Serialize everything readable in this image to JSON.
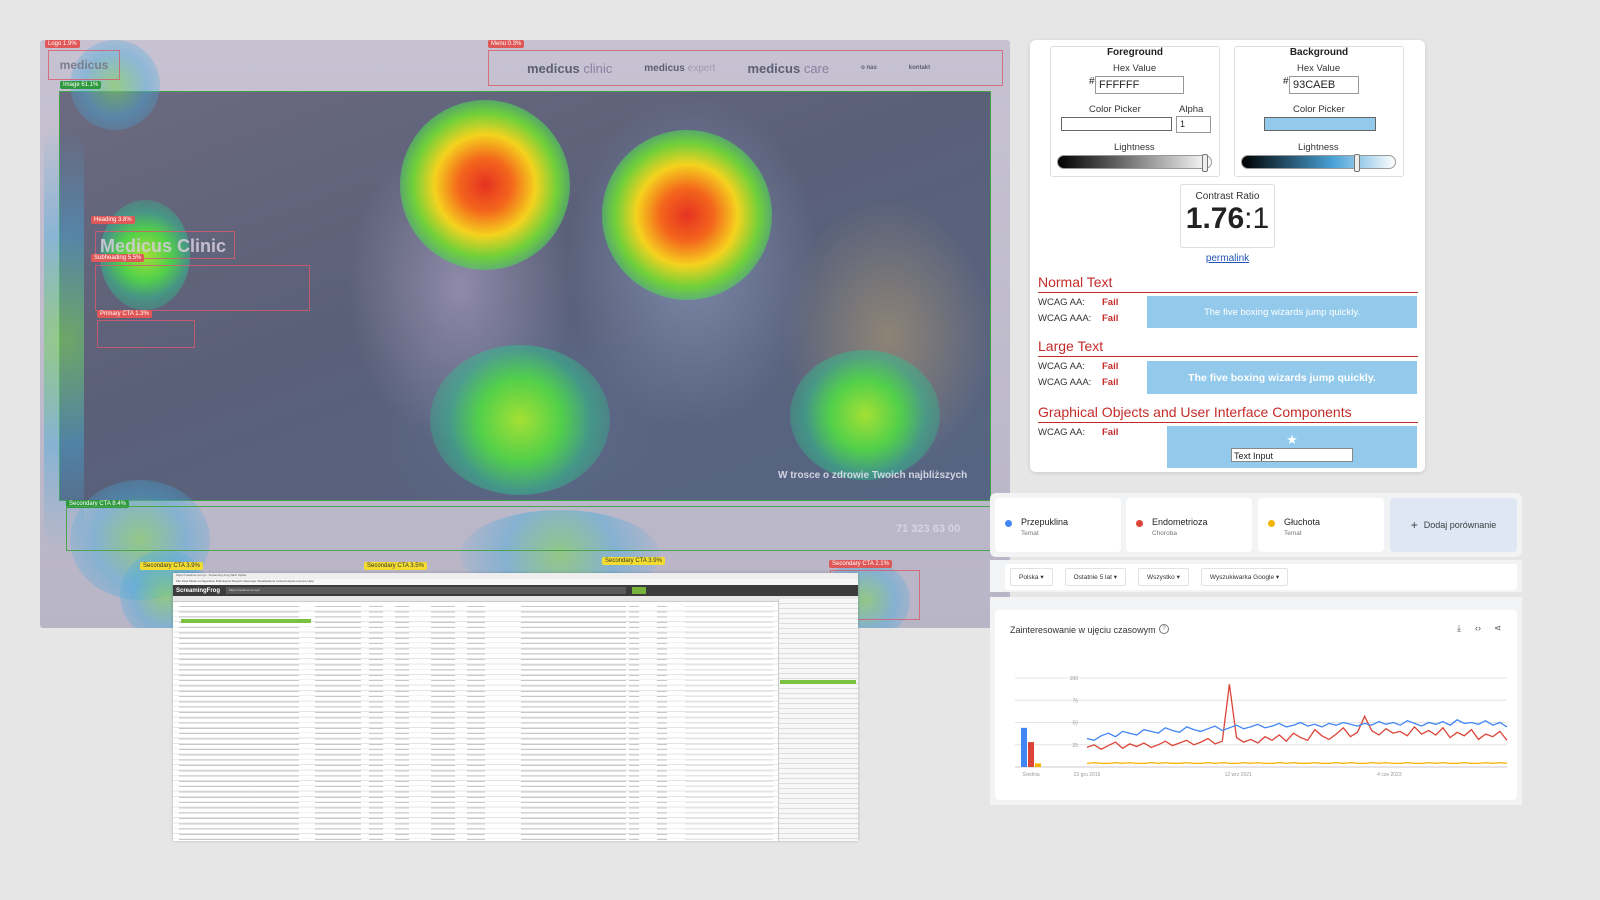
{
  "heatmap": {
    "logo_tag": "Logo 1.9%",
    "logo": "medicus",
    "image_tag": "Image 61.1%",
    "menu_tag": "Menu 0.3%",
    "nav": [
      {
        "brand": "medicus",
        "suffix": "clinic"
      },
      {
        "brand": "medicus",
        "suffix": "expert"
      },
      {
        "brand": "medicus",
        "suffix": "care"
      }
    ],
    "nav_small": [
      "o nas",
      "kontakt"
    ],
    "heading_tag": "Heading 3.8%",
    "heading": "Medicus Clinic",
    "subheading_tag": "Subheading 5.5%",
    "primary_cta_tag": "Primary CTA 1.3%",
    "tagline": "W trosce o zdrowie Twoich najbliższych",
    "secondary_cta_tag_bar": "Secondary CTA 8.4%",
    "secondary_cta_tags": [
      "Secondary CTA 3.9%",
      "Secondary CTA 3.5%",
      "Secondary CTA 3.9%",
      "Secondary CTA 2.1%"
    ],
    "phone": "71 323 63 00"
  },
  "screaming_frog": {
    "title": "https://medicus.com.pl - Screaming Frog SEO Spider",
    "menu": "File  View  Mode  Configuration  Bulk Export  Reports  Sitemaps  Visualisations  Crawl Analysis  Licence  Help",
    "logo": "ScreamingFrog",
    "url": "https://medicus.com.pl/"
  },
  "contrast": {
    "foreground": {
      "title": "Foreground",
      "hex_label": "Hex Value",
      "hex": "FFFFFF",
      "picker_label": "Color Picker",
      "alpha_label": "Alpha",
      "alpha": "1",
      "lightness_label": "Lightness"
    },
    "background": {
      "title": "Background",
      "hex_label": "Hex Value",
      "hex": "93CAEB",
      "picker_label": "Color Picker",
      "lightness_label": "Lightness"
    },
    "ratio_label": "Contrast Ratio",
    "ratio": "1.76",
    "ratio_suffix": ":1",
    "permalink": "permalink",
    "sections": [
      {
        "title": "Normal Text",
        "rows": [
          {
            "label": "WCAG AA:",
            "result": "Fail"
          },
          {
            "label": "WCAG AAA:",
            "result": "Fail"
          }
        ],
        "sample": "The five boxing wizards jump quickly."
      },
      {
        "title": "Large Text",
        "rows": [
          {
            "label": "WCAG AA:",
            "result": "Fail"
          },
          {
            "label": "WCAG AAA:",
            "result": "Fail"
          }
        ],
        "sample": "The five boxing wizards jump quickly."
      },
      {
        "title": "Graphical Objects and User Interface Components",
        "rows": [
          {
            "label": "WCAG AA:",
            "result": "Fail"
          }
        ],
        "sample": "Text Input"
      }
    ],
    "fg_color": "#FFFFFF",
    "bg_color": "#93CAEB"
  },
  "trends": {
    "terms": [
      {
        "name": "Przepuklina",
        "type": "Temat",
        "color": "#4285f4"
      },
      {
        "name": "Endometrioza",
        "type": "Choroba",
        "color": "#db4437"
      },
      {
        "name": "Głuchota",
        "type": "Temat",
        "color": "#f4b400"
      }
    ],
    "add_label": "Dodaj porównanie",
    "filters": [
      "Polska",
      "Ostatnie 5 lat",
      "Wszystko",
      "Wyszukiwarka Google"
    ],
    "chart_title": "Zainteresowanie w ujęciu czasowym",
    "chart_data": {
      "type": "line",
      "y_ticks": [
        "100",
        "75",
        "50",
        "25"
      ],
      "x_ticks": [
        "22 gru 2019",
        "12 wrz 2021",
        "4 cze 2023"
      ],
      "average_label": "Średnia",
      "averages": [
        {
          "name": "Przepuklina",
          "value": 44
        },
        {
          "name": "Endometrioza",
          "value": 28
        },
        {
          "name": "Głuchota",
          "value": 4
        }
      ],
      "ylim": [
        0,
        100
      ],
      "series": [
        {
          "name": "Przepuklina",
          "color": "#4285f4",
          "values": [
            32,
            30,
            35,
            38,
            34,
            40,
            38,
            36,
            42,
            40,
            38,
            44,
            41,
            39,
            45,
            42,
            40,
            43,
            46,
            41,
            44,
            47,
            43,
            45,
            48,
            44,
            46,
            49,
            45,
            47,
            50,
            46,
            48,
            45,
            49,
            47,
            50,
            48,
            46,
            49,
            47,
            51,
            48,
            50,
            47,
            52,
            49,
            46,
            50,
            48,
            51,
            47,
            53,
            49,
            50,
            48,
            52,
            47,
            50,
            45
          ]
        },
        {
          "name": "Endometrioza",
          "color": "#db4437",
          "values": [
            22,
            25,
            20,
            24,
            28,
            21,
            26,
            23,
            27,
            22,
            25,
            29,
            24,
            27,
            30,
            25,
            28,
            32,
            26,
            29,
            93,
            33,
            28,
            31,
            27,
            34,
            30,
            36,
            29,
            38,
            33,
            30,
            42,
            35,
            31,
            37,
            44,
            34,
            39,
            57,
            41,
            36,
            43,
            38,
            40,
            35,
            45,
            37,
            41,
            36,
            44,
            33,
            39,
            35,
            42,
            31,
            37,
            34,
            40,
            30
          ]
        },
        {
          "name": "Głuchota",
          "color": "#f4b400",
          "values": [
            4,
            5,
            4,
            4,
            5,
            4,
            5,
            4,
            4,
            5,
            4,
            5,
            4,
            4,
            5,
            4,
            4,
            5,
            4,
            5,
            4,
            4,
            5,
            4,
            5,
            4,
            4,
            5,
            4,
            5,
            4,
            4,
            5,
            4,
            4,
            5,
            4,
            5,
            4,
            4,
            5,
            4,
            5,
            4,
            4,
            5,
            4,
            4,
            5,
            4,
            5,
            4,
            4,
            5,
            4,
            4,
            5,
            4,
            5,
            4
          ]
        }
      ]
    }
  }
}
